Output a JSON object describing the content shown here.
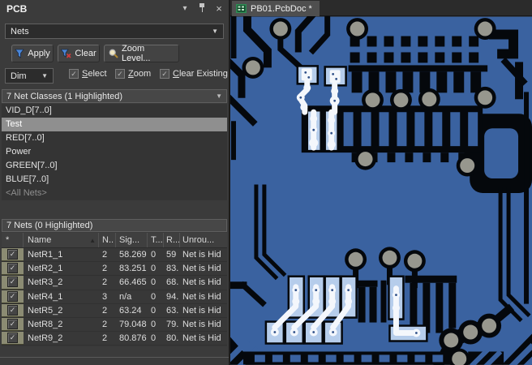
{
  "panel": {
    "title": "PCB",
    "header_icons": {
      "menu_glyph": "▾",
      "close_glyph": "×",
      "names": [
        "panel-menu-icon",
        "pin-icon",
        "close-icon"
      ]
    },
    "mode_dropdown": {
      "value": "Nets"
    },
    "toolbar": {
      "apply_label": "Apply",
      "clear_label": "Clear",
      "zoom_level_label": "Zoom Level..."
    },
    "options": {
      "dim_value": "Dim",
      "check_glyph": "✓",
      "checkboxes": [
        {
          "key": "S",
          "rest": "elect",
          "checked": true
        },
        {
          "key": "Z",
          "rest": "oom",
          "checked": true
        },
        {
          "key": "C",
          "rest": "lear Existing",
          "checked": true
        }
      ]
    },
    "net_classes": {
      "header": "7 Net Classes (1 Highlighted)",
      "items": [
        {
          "label": "VID_D[7..0]",
          "selected": false,
          "muted": false
        },
        {
          "label": "Test",
          "selected": true,
          "muted": false
        },
        {
          "label": "RED[7..0]",
          "selected": false,
          "muted": false
        },
        {
          "label": "Power",
          "selected": false,
          "muted": false
        },
        {
          "label": "GREEN[7..0]",
          "selected": false,
          "muted": false
        },
        {
          "label": "BLUE[7..0]",
          "selected": false,
          "muted": false
        },
        {
          "label": "<All Nets>",
          "selected": false,
          "muted": true
        }
      ]
    },
    "nets": {
      "header": "7 Nets (0 Highlighted)",
      "sort_glyph": "▲",
      "columns": [
        "*",
        "Name",
        "N..",
        "Sig...",
        "T...",
        "R...",
        "Unrou..."
      ],
      "rows": [
        {
          "checked": true,
          "name": "NetR1_1",
          "nodes": "2",
          "signal": "58.269",
          "t": "0",
          "routed": "59",
          "unrouted": "Net is Hid"
        },
        {
          "checked": true,
          "name": "NetR2_1",
          "nodes": "2",
          "signal": "83.251",
          "t": "0",
          "routed": "83.",
          "unrouted": "Net is Hid"
        },
        {
          "checked": true,
          "name": "NetR3_2",
          "nodes": "2",
          "signal": "66.465",
          "t": "0",
          "routed": "68.",
          "unrouted": "Net is Hid"
        },
        {
          "checked": true,
          "name": "NetR4_1",
          "nodes": "3",
          "signal": "n/a",
          "t": "0",
          "routed": "94.",
          "unrouted": "Net is Hid"
        },
        {
          "checked": true,
          "name": "NetR5_2",
          "nodes": "2",
          "signal": "63.24",
          "t": "0",
          "routed": "63.",
          "unrouted": "Net is Hid"
        },
        {
          "checked": true,
          "name": "NetR8_2",
          "nodes": "2",
          "signal": "79.048",
          "t": "0",
          "routed": "79.",
          "unrouted": "Net is Hid"
        },
        {
          "checked": true,
          "name": "NetR9_2",
          "nodes": "2",
          "signal": "80.876",
          "t": "0",
          "routed": "80.",
          "unrouted": "Net is Hid"
        }
      ]
    }
  },
  "editor": {
    "tab": {
      "label": "PB01.PcbDoc *",
      "icon": "pcbdoc-icon"
    },
    "colors": {
      "copper_dimmed": "#3a62a0",
      "board_dark": "#05080c",
      "via_pad_gray": "#97978e",
      "highlight_pad": "#b6cdeb",
      "highlight_trace": "#f4f7fc",
      "selected_row": "#8f8f8f",
      "checkbox_cell": "#8b8b73"
    }
  }
}
